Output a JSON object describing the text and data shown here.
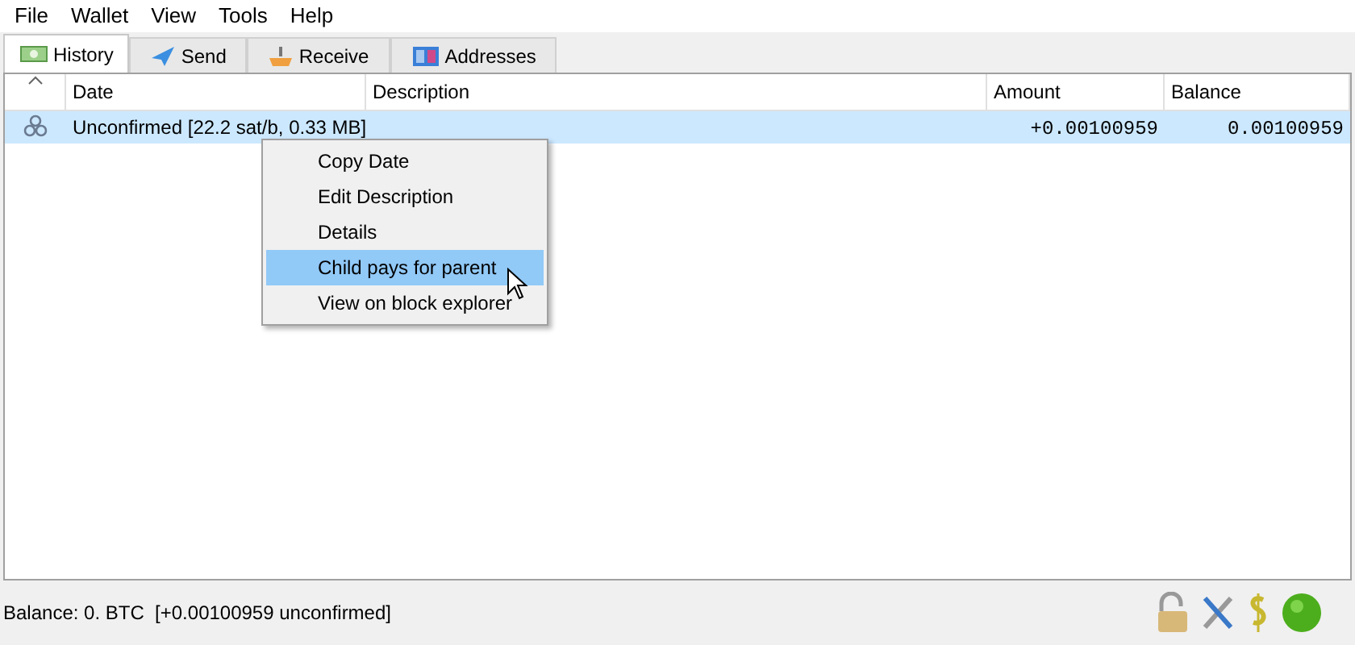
{
  "menu_bar": [
    "File",
    "Wallet",
    "View",
    "Tools",
    "Help"
  ],
  "tabs": [
    {
      "label": "History",
      "kind": "history",
      "selected": true
    },
    {
      "label": "Send",
      "kind": "send",
      "selected": false
    },
    {
      "label": "Receive",
      "kind": "receive",
      "selected": false
    },
    {
      "label": "Addresses",
      "kind": "addresses",
      "selected": false
    }
  ],
  "table": {
    "columns": [
      "Date",
      "Description",
      "Amount",
      "Balance"
    ],
    "rows": [
      {
        "date": "Unconfirmed [22.2 sat/b, 0.33 MB]",
        "description": "",
        "amount": "+0.00100959",
        "balance": "0.00100959",
        "selected": true
      }
    ]
  },
  "context_menu": {
    "items": [
      {
        "label": "Copy Date",
        "selected": false
      },
      {
        "label": "Edit Description",
        "selected": false
      },
      {
        "label": "Details",
        "selected": false
      },
      {
        "label": "Child pays for parent",
        "selected": true
      },
      {
        "label": "View on block explorer",
        "selected": false
      }
    ]
  },
  "status_bar": {
    "text": "Balance: 0. BTC  [+0.00100959 unconfirmed]"
  }
}
